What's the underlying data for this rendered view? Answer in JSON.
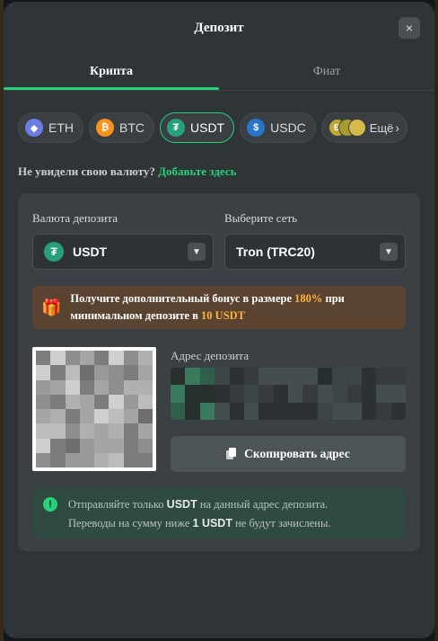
{
  "modal": {
    "title": "Депозит",
    "close_label": "×"
  },
  "tabs": [
    {
      "label": "Крипта",
      "active": true
    },
    {
      "label": "Фиат",
      "active": false
    }
  ],
  "currencies": [
    {
      "label": "ETH",
      "icon": "ethereum-icon",
      "glyph": "◆",
      "active": false
    },
    {
      "label": "BTC",
      "icon": "bitcoin-icon",
      "glyph": "₿",
      "active": false
    },
    {
      "label": "USDT",
      "icon": "tether-icon",
      "glyph": "₮",
      "active": true
    },
    {
      "label": "USDC",
      "icon": "usdc-icon",
      "glyph": "$",
      "active": false
    }
  ],
  "more": {
    "label": "Ещё",
    "glyph_1": "Ð"
  },
  "note": {
    "text": "Не увидели свою валюту?",
    "link": "Добавьте здесь"
  },
  "deposit_currency": {
    "label": "Валюта депозита",
    "value": "USDT",
    "glyph": "₮"
  },
  "network": {
    "label": "Выберите сеть",
    "value": "Tron (TRC20)"
  },
  "bonus": {
    "text_1": "Получите дополнительный бонус в размере ",
    "percent": "180%",
    "text_2": " при",
    "text_3": "минимальном депозите в ",
    "amount": "10 USDT"
  },
  "address": {
    "label": "Адрес депозита",
    "copy_label": "Скопировать адрес"
  },
  "info": {
    "line1_a": "Отправляйте только ",
    "line1_b": "USDT",
    "line1_c": " на данный адрес депозита.",
    "line2_a": "Переводы на сумму ниже ",
    "line2_b": "1 USDT",
    "line2_c": " не будут зачислены."
  },
  "colors": {
    "accent": "#25d27a",
    "bonus_highlight": "#ffb23e",
    "modal_bg": "#2f3437"
  }
}
